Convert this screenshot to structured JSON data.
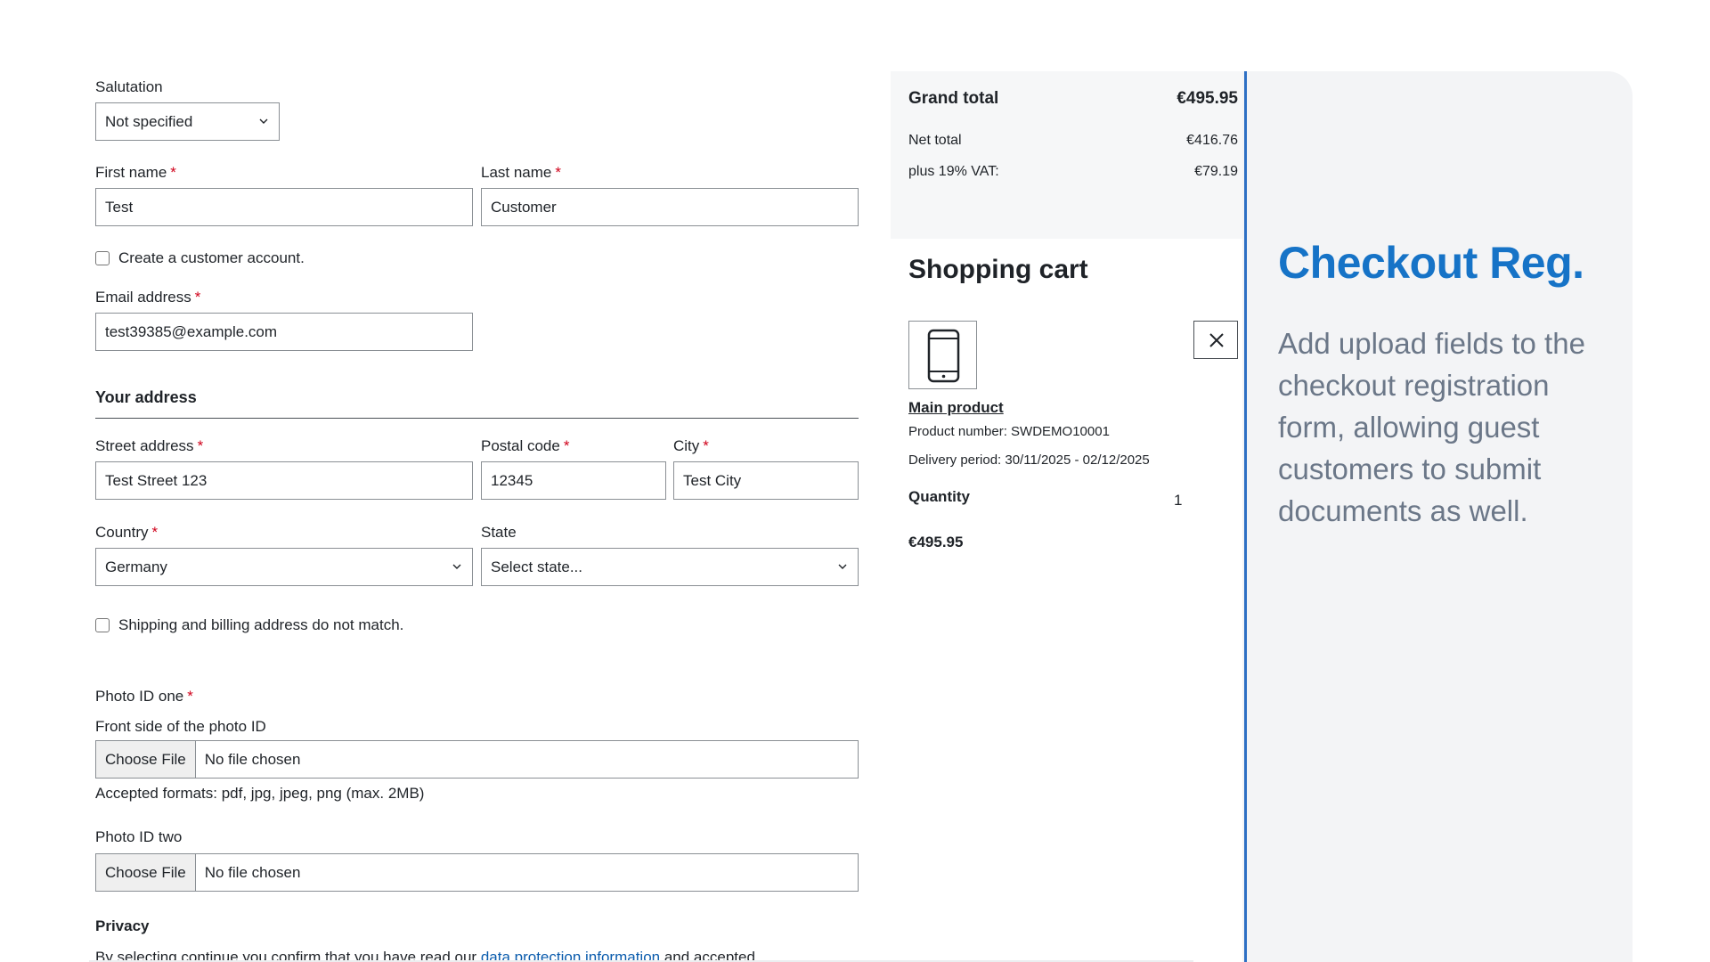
{
  "form": {
    "salutation": {
      "label": "Salutation",
      "value": "Not specified"
    },
    "first_name": {
      "label": "First name",
      "required": "*",
      "value": "Test"
    },
    "last_name": {
      "label": "Last name",
      "required": "*",
      "value": "Customer"
    },
    "create_account_label": "Create a customer account.",
    "email": {
      "label": "Email address",
      "required": "*",
      "value": "test39385@example.com"
    },
    "address_heading": "Your address",
    "street": {
      "label": "Street address",
      "required": "*",
      "value": "Test Street 123"
    },
    "postal": {
      "label": "Postal code",
      "required": "*",
      "value": "12345"
    },
    "city": {
      "label": "City",
      "required": "*",
      "value": "Test City"
    },
    "country": {
      "label": "Country",
      "required": "*",
      "value": "Germany"
    },
    "state": {
      "label": "State",
      "value": "Select state..."
    },
    "shipping_mismatch_label": "Shipping and billing address do not match.",
    "photo_one": {
      "label": "Photo ID one",
      "required": "*",
      "sublabel": "Front side of the photo ID",
      "button": "Choose File",
      "file": "No file chosen",
      "help": "Accepted formats: pdf, jpg, jpeg, png (max. 2MB)"
    },
    "photo_two": {
      "label": "Photo ID two",
      "button": "Choose File",
      "file": "No file chosen"
    },
    "privacy": {
      "heading": "Privacy",
      "text_before": "By selecting continue you confirm that you have read our ",
      "link": "data protection information",
      "text_after": " and accepted"
    }
  },
  "cart": {
    "grand_total_label": "Grand total",
    "grand_total": "€495.95",
    "net_total_label": "Net total",
    "net_total": "€416.76",
    "vat_label": "plus 19% VAT:",
    "vat": "€79.19",
    "title": "Shopping cart",
    "item": {
      "name": "Main product",
      "product_number": "Product number: SWDEMO10001",
      "delivery": "Delivery period: 30/11/2025 - 02/12/2025",
      "quantity_label": "Quantity",
      "quantity": "1",
      "price": "€495.95",
      "icon": "smartphone-icon"
    }
  },
  "promo": {
    "title": "Checkout Reg.",
    "text": "Add upload fields to the checkout registration form, allowing guest customers to submit documents as well.",
    "accent_color": "#1673c7"
  }
}
